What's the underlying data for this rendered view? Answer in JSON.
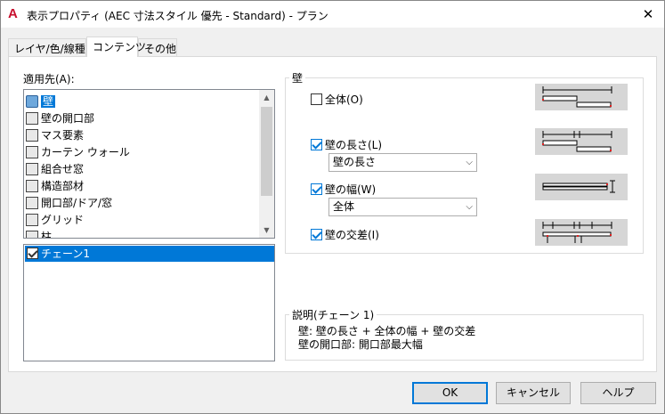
{
  "window": {
    "title": "表示プロパティ (AEC 寸法スタイル 優先 - Standard) - プラン",
    "app_icon": "A"
  },
  "tabs": [
    {
      "label": "レイヤ/色/線種"
    },
    {
      "label": "コンテンツ"
    },
    {
      "label": "その他"
    }
  ],
  "apply_to": {
    "label": "適用先(A):",
    "items": [
      {
        "label": "壁",
        "icon": "wall-icon",
        "selected": true
      },
      {
        "label": "壁の開口部",
        "icon": "wall-opening-icon"
      },
      {
        "label": "マス要素",
        "icon": "mass-element-icon"
      },
      {
        "label": "カーテン ウォール",
        "icon": "curtain-wall-icon"
      },
      {
        "label": "組合せ窓",
        "icon": "window-assembly-icon"
      },
      {
        "label": "構造部材",
        "icon": "structural-member-icon"
      },
      {
        "label": "開口部/ドア/窓",
        "icon": "opening-door-window-icon"
      },
      {
        "label": "グリッド",
        "icon": "grid-icon"
      },
      {
        "label": "柱",
        "icon": "column-icon"
      }
    ]
  },
  "chains": {
    "items": [
      {
        "label": "チェーン1",
        "checked": true
      }
    ]
  },
  "wall_group": {
    "title": "壁",
    "overall": {
      "label": "全体(O)",
      "checked": false
    },
    "length": {
      "label": "壁の長さ(L)",
      "checked": true,
      "combo_value": "壁の長さ"
    },
    "width": {
      "label": "壁の幅(W)",
      "checked": true,
      "combo_value": "全体"
    },
    "intersections": {
      "label": "壁の交差(I)",
      "checked": true
    }
  },
  "description": {
    "title": "説明(チェーン 1)",
    "line1": "壁: 壁の長さ + 全体の幅 + 壁の交差",
    "line2": "壁の開口部: 開口部最大幅"
  },
  "buttons": {
    "ok": "OK",
    "cancel": "キャンセル",
    "help": "ヘルプ"
  },
  "colors": {
    "selection": "#0078d7",
    "preview_bg": "#d6d6d6",
    "marker_red": "#e02020"
  }
}
